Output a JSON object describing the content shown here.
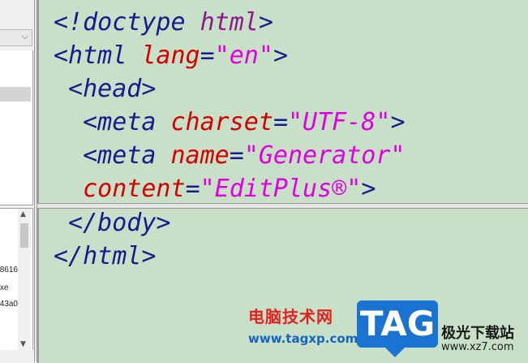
{
  "left_panel": {
    "combo_arrow": "⌵",
    "files": [
      "8616",
      "xe",
      "43a0"
    ]
  },
  "editor_top": {
    "lines": [
      [
        {
          "t": "<!doctype ",
          "c": "c-navy"
        },
        {
          "t": "html",
          "c": "c-purple"
        },
        {
          "t": ">",
          "c": "c-navy"
        }
      ],
      [
        {
          "t": "<html ",
          "c": "c-navy"
        },
        {
          "t": "lang",
          "c": "c-red"
        },
        {
          "t": "=",
          "c": "c-navy"
        },
        {
          "t": "\"en\"",
          "c": "c-mag"
        },
        {
          "t": ">",
          "c": "c-navy"
        }
      ],
      [
        {
          "t": " <head>",
          "c": "c-navy"
        }
      ],
      [
        {
          "t": "  <meta ",
          "c": "c-navy"
        },
        {
          "t": "charset",
          "c": "c-red"
        },
        {
          "t": "=",
          "c": "c-navy"
        },
        {
          "t": "\"UTF-8\"",
          "c": "c-mag"
        },
        {
          "t": ">",
          "c": "c-navy"
        }
      ],
      [
        {
          "t": "  <meta ",
          "c": "c-navy"
        },
        {
          "t": "name",
          "c": "c-red"
        },
        {
          "t": "=",
          "c": "c-navy"
        },
        {
          "t": "\"Generator\"",
          "c": "c-mag"
        }
      ],
      [
        {
          "t": "  content",
          "c": "c-red"
        },
        {
          "t": "=",
          "c": "c-navy"
        },
        {
          "t": "\"EditPlus®\"",
          "c": "c-mag"
        },
        {
          "t": ">",
          "c": "c-navy"
        }
      ]
    ]
  },
  "editor_bottom": {
    "lines": [
      [
        {
          "t": " </body>",
          "c": "c-navy"
        }
      ],
      [
        {
          "t": "</html>",
          "c": "c-navy"
        }
      ]
    ]
  },
  "watermark": {
    "cn_title": "电脑技术网",
    "url": "www.tagxp.com",
    "tag": "TAG",
    "right_line1": "极光下载站",
    "right_line2": "www.xz7.com"
  },
  "colors": {
    "editor_bg": "#c7e0c7",
    "tag_navy": "#1a1a8c",
    "attr_red": "#d60000",
    "string_magenta": "#e000e0",
    "keyword_purple": "#8b1a8b"
  }
}
